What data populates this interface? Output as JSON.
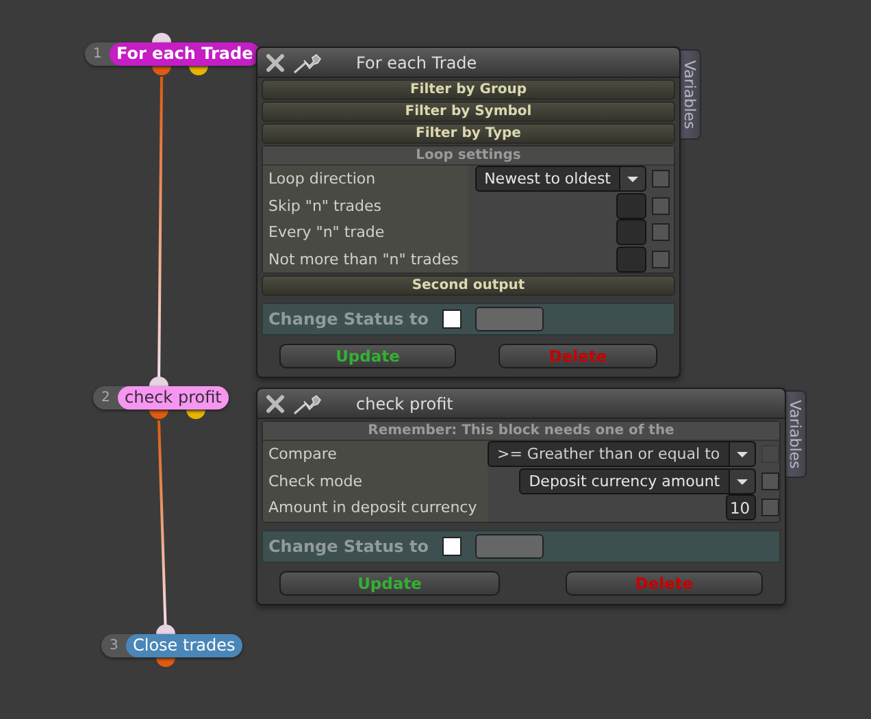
{
  "nodes": [
    {
      "number": "1",
      "label": "For each Trade",
      "color": "#c41ec4"
    },
    {
      "number": "2",
      "label": "check profit",
      "color": "#f596f0"
    },
    {
      "number": "3",
      "label": "Close trades",
      "color": "#4a86b8"
    }
  ],
  "panels": [
    {
      "title": "For each Trade",
      "tab": "Variables",
      "sections": [
        {
          "kind": "header",
          "label": "Filter by Group"
        },
        {
          "kind": "header",
          "label": "Filter by Symbol"
        },
        {
          "kind": "header",
          "label": "Filter by Type"
        },
        {
          "kind": "group",
          "title": "Loop settings",
          "rows": [
            {
              "label": "Loop direction",
              "kind": "select",
              "value": "Newest to oldest",
              "disabled": false
            },
            {
              "label": "Skip \"n\" trades",
              "kind": "number",
              "disabled": false
            },
            {
              "label": "Every \"n\" trade",
              "kind": "number",
              "disabled": false
            },
            {
              "label": "Not more than \"n\" trades",
              "kind": "number",
              "disabled": false
            }
          ]
        },
        {
          "kind": "header",
          "label": "Second output"
        }
      ],
      "status": "Change Status to",
      "buttons": [
        {
          "kind": "update",
          "label": "Update"
        },
        {
          "kind": "delete",
          "label": "Delete"
        }
      ]
    },
    {
      "title": "check profit",
      "tab": "Variables",
      "sections": [
        {
          "kind": "group",
          "title": "Remember: This block needs one of the",
          "rows": [
            {
              "label": "Compare",
              "kind": "select",
              "value": ">= Greather than or equal to",
              "disabled": true
            },
            {
              "label": "Check mode",
              "kind": "select",
              "value": "Deposit currency amount",
              "disabled": false
            },
            {
              "label": "Amount in deposit currency",
              "kind": "number",
              "value": "10",
              "disabled": false
            }
          ]
        }
      ],
      "status": "Change Status to",
      "buttons": [
        {
          "kind": "update",
          "label": "Update"
        },
        {
          "kind": "delete",
          "label": "Delete"
        }
      ]
    }
  ]
}
